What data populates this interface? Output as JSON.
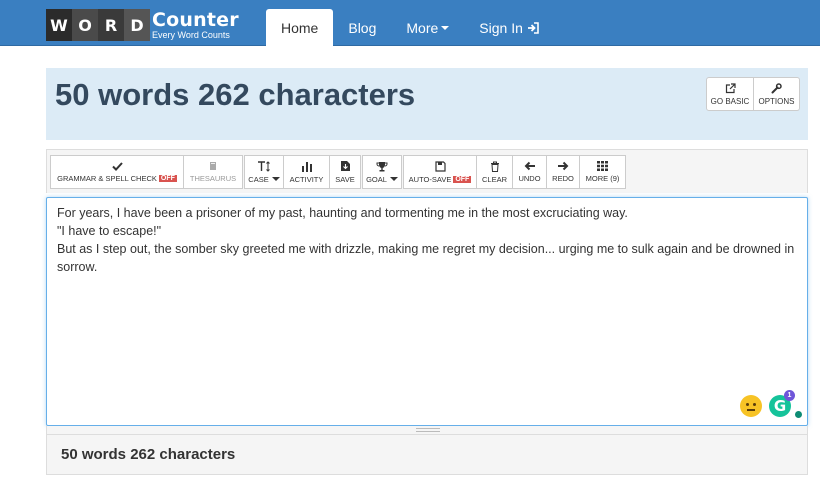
{
  "logo": {
    "letters": [
      "W",
      "O",
      "R",
      "D"
    ],
    "title": "Counter",
    "subtitle": "Every Word Counts"
  },
  "nav": [
    {
      "label": "Home",
      "active": true
    },
    {
      "label": "Blog"
    },
    {
      "label": "More"
    },
    {
      "label": "Sign In"
    }
  ],
  "header": {
    "title": "50 words 262 characters",
    "go_basic": "GO BASIC",
    "options": "OPTIONS"
  },
  "toolbar": {
    "grammar": "GRAMMAR & SPELL CHECK",
    "grammar_badge": "OFF",
    "thesaurus": "THESAURUS",
    "case": "CASE",
    "activity": "ACTIVITY",
    "save": "SAVE",
    "goal": "GOAL",
    "autosave": "AUTO-SAVE",
    "autosave_badge": "OFF",
    "clear": "CLEAR",
    "undo": "UNDO",
    "redo": "REDO",
    "more": "MORE (9)"
  },
  "editor": {
    "lines": [
      "For years, I have been a prisoner of my past, haunting and tormenting me in the most excruciating way.",
      "\"I have to escape!\"",
      "But as I step out, the somber sky greeted me with drizzle, making me regret my decision... urging me to sulk again and be drowned in sorrow."
    ]
  },
  "grammarly": {
    "letter": "G",
    "badge": "1"
  },
  "footer": {
    "count": "50 words 262 characters"
  },
  "colors": {
    "navbar": "#3a7fc1",
    "header_bg": "#dcebf6",
    "title": "#34495e",
    "off_badge": "#d9534f",
    "grammarly": "#15c39a"
  }
}
